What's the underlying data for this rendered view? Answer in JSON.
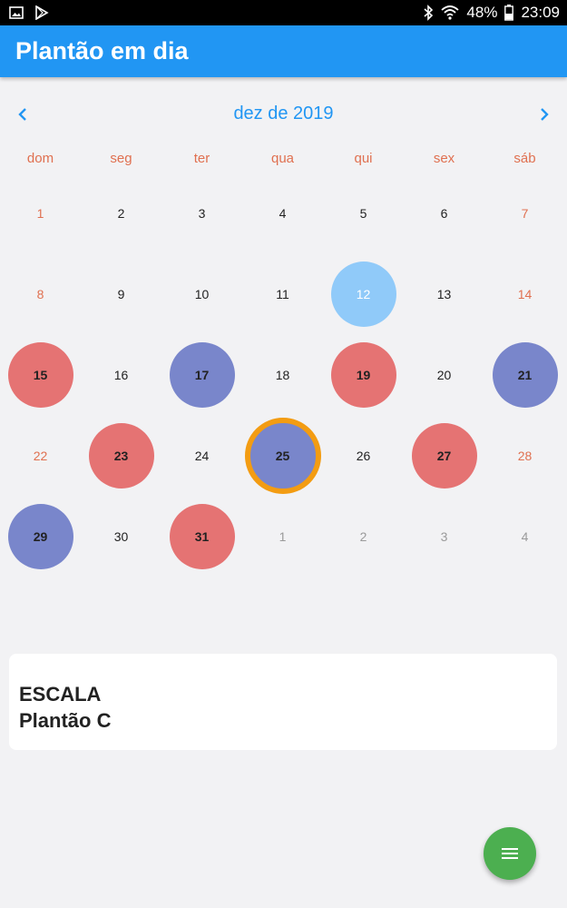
{
  "status_bar": {
    "battery": "48%",
    "time": "23:09",
    "icons": [
      "gallery-icon",
      "play-store-icon",
      "bluetooth-icon",
      "wifi-icon",
      "battery-icon"
    ]
  },
  "app_bar": {
    "title": "Plantão em dia"
  },
  "calendar": {
    "month_label": "dez de 2019",
    "prev_icon": "chevron-left-icon",
    "next_icon": "chevron-right-icon",
    "weekdays": [
      "dom",
      "seg",
      "ter",
      "qua",
      "qui",
      "sex",
      "sáb"
    ],
    "weeks": [
      [
        {
          "day": "1",
          "type": "weekend"
        },
        {
          "day": "2"
        },
        {
          "day": "3"
        },
        {
          "day": "4"
        },
        {
          "day": "5"
        },
        {
          "day": "6"
        },
        {
          "day": "7",
          "type": "weekend"
        }
      ],
      [
        {
          "day": "8",
          "type": "weekend"
        },
        {
          "day": "9"
        },
        {
          "day": "10"
        },
        {
          "day": "11"
        },
        {
          "day": "12",
          "fill": "#90caf9",
          "selected": true
        },
        {
          "day": "13"
        },
        {
          "day": "14",
          "type": "weekend"
        }
      ],
      [
        {
          "day": "15",
          "fill": "#e57373"
        },
        {
          "day": "16"
        },
        {
          "day": "17",
          "fill": "#7986cb"
        },
        {
          "day": "18"
        },
        {
          "day": "19",
          "fill": "#e57373"
        },
        {
          "day": "20"
        },
        {
          "day": "21",
          "fill": "#7986cb"
        }
      ],
      [
        {
          "day": "22",
          "type": "weekend"
        },
        {
          "day": "23",
          "fill": "#e57373"
        },
        {
          "day": "24"
        },
        {
          "day": "25",
          "fill": "#7986cb",
          "border": "#f39c12",
          "today": true
        },
        {
          "day": "26"
        },
        {
          "day": "27",
          "fill": "#e57373"
        },
        {
          "day": "28",
          "type": "weekend"
        }
      ],
      [
        {
          "day": "29",
          "fill": "#7986cb"
        },
        {
          "day": "30"
        },
        {
          "day": "31",
          "fill": "#e57373"
        },
        {
          "day": "1",
          "type": "outside"
        },
        {
          "day": "2",
          "type": "outside"
        },
        {
          "day": "3",
          "type": "outside"
        },
        {
          "day": "4",
          "type": "outside"
        }
      ]
    ]
  },
  "card": {
    "line1": "ESCALA",
    "line2": "Plantão C"
  },
  "fab": {
    "icon": "menu-icon"
  },
  "colors": {
    "primary": "#2196f3",
    "weekend": "#e07050",
    "fab": "#4caf50",
    "red_shift": "#e57373",
    "blue_shift": "#7986cb",
    "selected": "#90caf9",
    "today_ring": "#f39c12"
  }
}
